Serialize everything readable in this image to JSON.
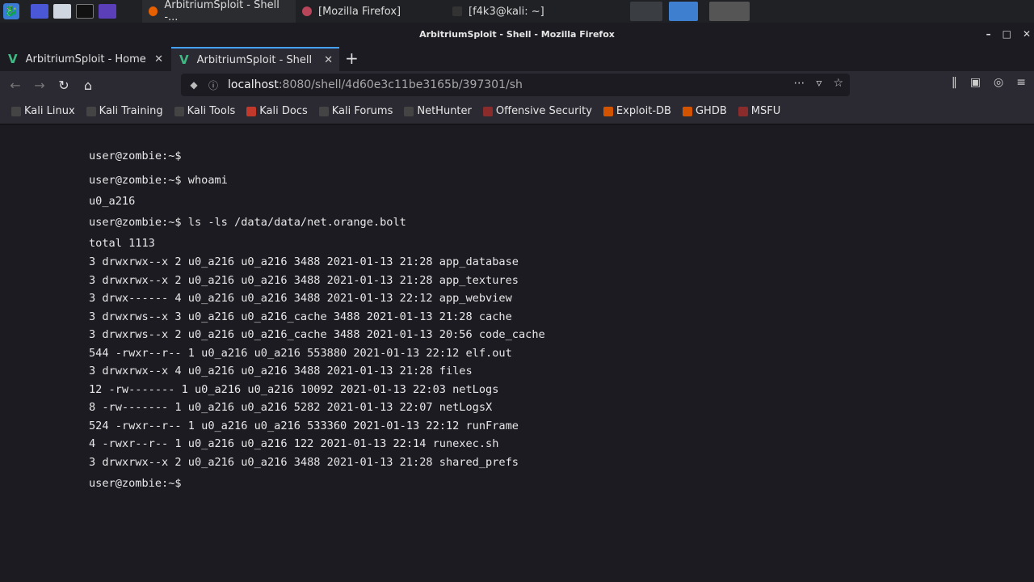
{
  "taskbar": {
    "tasks": [
      {
        "label": "ArbitriumSploit - Shell -..."
      },
      {
        "label": "[Mozilla Firefox]"
      },
      {
        "label": "[f4k3@kali: ~]"
      }
    ]
  },
  "window": {
    "title": "ArbitriumSploit - Shell - Mozilla Firefox"
  },
  "tabs": [
    {
      "label": "ArbitriumSploit - Home"
    },
    {
      "label": "ArbitriumSploit - Shell"
    }
  ],
  "url": {
    "host": "localhost",
    "path": ":8080/shell/4d60e3c11be3165b/397301/sh"
  },
  "bookmarks": [
    {
      "label": "Kali Linux"
    },
    {
      "label": "Kali Training"
    },
    {
      "label": "Kali Tools"
    },
    {
      "label": "Kali Docs"
    },
    {
      "label": "Kali Forums"
    },
    {
      "label": "NetHunter"
    },
    {
      "label": "Offensive Security"
    },
    {
      "label": "Exploit-DB"
    },
    {
      "label": "GHDB"
    },
    {
      "label": "MSFU"
    }
  ],
  "terminal": {
    "lines": [
      "user@zombie:~$",
      "user@zombie:~$ whoami",
      "u0_a216",
      "user@zombie:~$ ls -ls /data/data/net.orange.bolt",
      "total 1113",
      "3 drwxrwx--x 2 u0_a216 u0_a216 3488 2021-01-13 21:28 app_database",
      "3 drwxrwx--x 2 u0_a216 u0_a216 3488 2021-01-13 21:28 app_textures",
      "3 drwx------ 4 u0_a216 u0_a216 3488 2021-01-13 22:12 app_webview",
      "3 drwxrws--x 3 u0_a216 u0_a216_cache 3488 2021-01-13 21:28 cache",
      "3 drwxrws--x 2 u0_a216 u0_a216_cache 3488 2021-01-13 20:56 code_cache",
      "544 -rwxr--r-- 1 u0_a216 u0_a216 553880 2021-01-13 22:12 elf.out",
      "3 drwxrwx--x 4 u0_a216 u0_a216 3488 2021-01-13 21:28 files",
      "12 -rw------- 1 u0_a216 u0_a216 10092 2021-01-13 22:03 netLogs",
      "8 -rw------- 1 u0_a216 u0_a216 5282 2021-01-13 22:07 netLogsX",
      "524 -rwxr--r-- 1 u0_a216 u0_a216 533360 2021-01-13 22:12 runFrame",
      "4 -rwxr--r-- 1 u0_a216 u0_a216 122 2021-01-13 22:14 runexec.sh",
      "3 drwxrwx--x 2 u0_a216 u0_a216 3488 2021-01-13 21:28 shared_prefs",
      "user@zombie:~$"
    ]
  },
  "colors": {
    "tab_accent": "#45a1ff",
    "vue_green": "#41b883"
  }
}
